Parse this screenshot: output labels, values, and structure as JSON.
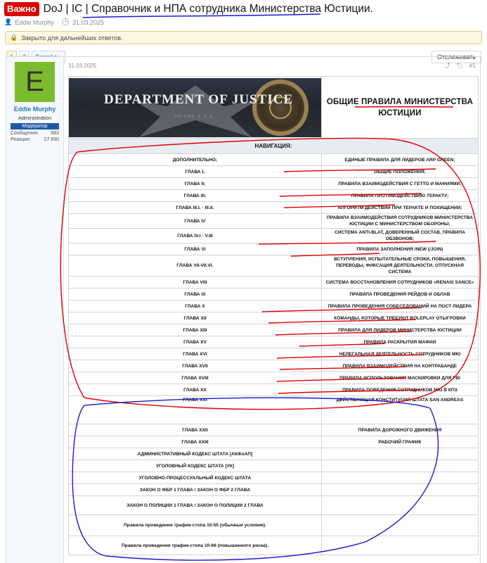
{
  "thread": {
    "prefix": "Важно",
    "title": "DoJ | IC | Справочник и НПА сотрудника Министерства Юстиции.",
    "author": "Eddie Murphy",
    "date": "31.03.2025"
  },
  "notice": {
    "text": "Закрыто для дальнейших ответов."
  },
  "pager": {
    "pages": [
      "1",
      "2"
    ],
    "next": "Вперёд",
    "watch": "Отслеживать"
  },
  "user": {
    "avatar_letter": "E",
    "name": "Eddie Murphy",
    "title": "Administration",
    "badge": "Модератор",
    "messages_label": "Сообщения:",
    "messages": "683",
    "reactions_label": "Реакции:",
    "reactions": "27 890"
  },
  "post": {
    "date": "31.03.2025",
    "number": "#1"
  },
  "doc": {
    "banner_text": "DEPARTMENT OF JUSTICE",
    "banner_sub": "OF THE U.S.A.",
    "heading": "ОБЩИЕ ПРАВИЛА МИНИСТЕРСТВА ЮСТИЦИИ",
    "nav": "НАВИГАЦИЯ:",
    "rows": [
      {
        "left": "ДОПОЛНИТЕЛЬНО;",
        "right": "ЕДИНЫЕ ПРАВИЛА ДЛЯ ЛИДЕРОВ ARP GREEN;"
      },
      {
        "left": "ГЛАВА I;",
        "right": "ОБЩИЕ ПОЛОЖЕНИЯ;"
      },
      {
        "left": "ГЛАВА II;",
        "right": "ПРАВИЛА ВЗАИМОДЕЙСТВИЯ С ГЕТТО И МАФИЯМИ;"
      },
      {
        "left": "ГЛАВА III;",
        "right": "ПРАВИЛА ПРОТИВОДЕЙСТВИЮ ТЕРАКТУ;"
      },
      {
        "left": "ГЛАВА III.I. - III.II.",
        "right": "АЛГОРИТМ ДЕЙСТВИЙ ПРИ ТЕРАКТЕ И ПОХИЩЕНИИ;"
      },
      {
        "left": "ГЛАВА IV",
        "right": "ПРАВИЛА ВЗАИМОДЕЙСТВИЯ СОТРУДНИКОВ МИНИСТЕРСТВА ЮСТИЦИИ С МИНИСТЕРСТВОМ ОБОРОНЫ;"
      },
      {
        "left": "ГЛАВА IV.I - V.III",
        "right": "СИСТЕМА ANTI-BLAT, ДОВЕРЕННЫЙ СОСТАВ, ПРАВИЛА ОБЗВОНОВ;"
      },
      {
        "left": "ГЛАВА VI",
        "right": "ПРАВИЛА ЗАПОЛНЕНИЯ /NEW (/JOIN)"
      },
      {
        "left": "ГЛАВА VII-VII.VI.",
        "right": "ВСТУПЛЕНИЯ, ИСПЫТАТЕЛЬНЫЕ СРОКИ, ПОВЫШЕНИЯ, ПЕРЕВОДЫ, ФИКСАЦИЯ ДЕЯТЕЛЬНОСТИ, ОТПУСКНАЯ СИСТЕМА"
      },
      {
        "left": "ГЛАВА VIII",
        "right": "СИСТЕМА ВОССТАНОВЛЕНИЯ СОТРУДНИКОВ «RENAIS SANCE»"
      },
      {
        "left": "ГЛАВА IX",
        "right": "ПРАВИЛА ПРОВЕДЕНИЯ РЕЙДОВ И ОБЛАВ"
      },
      {
        "left": "ГЛАВА X",
        "right": "ПРАВИЛА ПРОВЕДЕНИЯ СОБЕСЕДОВАНИЙ НА ПОСТ ЛИДЕРА"
      },
      {
        "left": "ГЛАВА XII",
        "right": "КОМАНДЫ, КОТОРЫЕ ТРЕБУЮТ ROLEPLAY ОТЫГРОВКИ"
      },
      {
        "left": "ГЛАВА XIII",
        "right": "ПРАВИЛА ДЛЯ ЛИДЕРОВ МИНИСТЕРСТВА ЮСТИЦИИ"
      },
      {
        "left": "ГЛАВА XV",
        "right": "ПРАВИЛА РАСКРЫТИЯ МАФИИ"
      },
      {
        "left": "ГЛАВА XVI",
        "right": "НЕЛЕГАЛЬНАЯ ДЕЯТЕЛЬНОСТЬ СОТРУДНИКОВ МЮ"
      },
      {
        "left": "ГЛАВА XVII",
        "right": "ПРАВИЛА ВЗАИМОДЕЙСТВИЯ НА КОНТРАБАНДЕ"
      },
      {
        "left": "ГЛАВА XVIII",
        "right": "ПРАВИЛА ИСПОЛЬЗОВАНИЯ МАСКИРОВКИ ДЛЯ FBI"
      },
      {
        "left": "ГЛАВА XX",
        "right": "ПРАВИЛА ПОВЕДЕНИЯ СОТРУДНИКОВ МЮ В КПЗ"
      },
      {
        "left": "ГЛАВА XXI",
        "right": "ДЕЙСТВУЮЩАЯ КОНСТИТУЦИЯ ШТАТА SAN ANDREAS"
      },
      {
        "left": "ГЛАВА XXII",
        "right": "ПРАВИЛА ДОРОЖНОГО ДВИЖЕНИЯ"
      },
      {
        "left": "ГЛАВА XXIII",
        "right": "РАБОЧИЙ ГРАФИК"
      },
      {
        "left": "АДМИНИСТРАТИВНЫЙ КОДЕКС ШТАТА [АК/КоАП]",
        "right": ""
      },
      {
        "left": "УГОЛОВНЫЙ КОДЕКС ШТАТА [УК]",
        "right": ""
      },
      {
        "left": "УГОЛОВНО-ПРОЦЕССУАЛЬНЫЙ КОДЕКС ШТАТА",
        "right": ""
      },
      {
        "left": "ЗАКОН О ФБР 1 ГЛАВА / ЗАКОН О ФБР 2 ГЛАВА",
        "right": ""
      },
      {
        "left": "ЗАКОН О ПОЛИЦИИ 1 ГЛАВА / ЗАКОН О ПОЛИЦИИ 2 ГЛАВА",
        "right": ""
      },
      {
        "left": "Правила проведения трафик-стопа 10-55 (обычные условия).",
        "right": ""
      },
      {
        "left": "Правила проведения трафик-стопа 10-66 (повышенного риска).",
        "right": ""
      }
    ]
  },
  "colors": {
    "accent": "#2577b1",
    "prefix_bg": "#dd0000",
    "marker_red": "#e00000",
    "marker_blue": "#1a1ad6"
  }
}
